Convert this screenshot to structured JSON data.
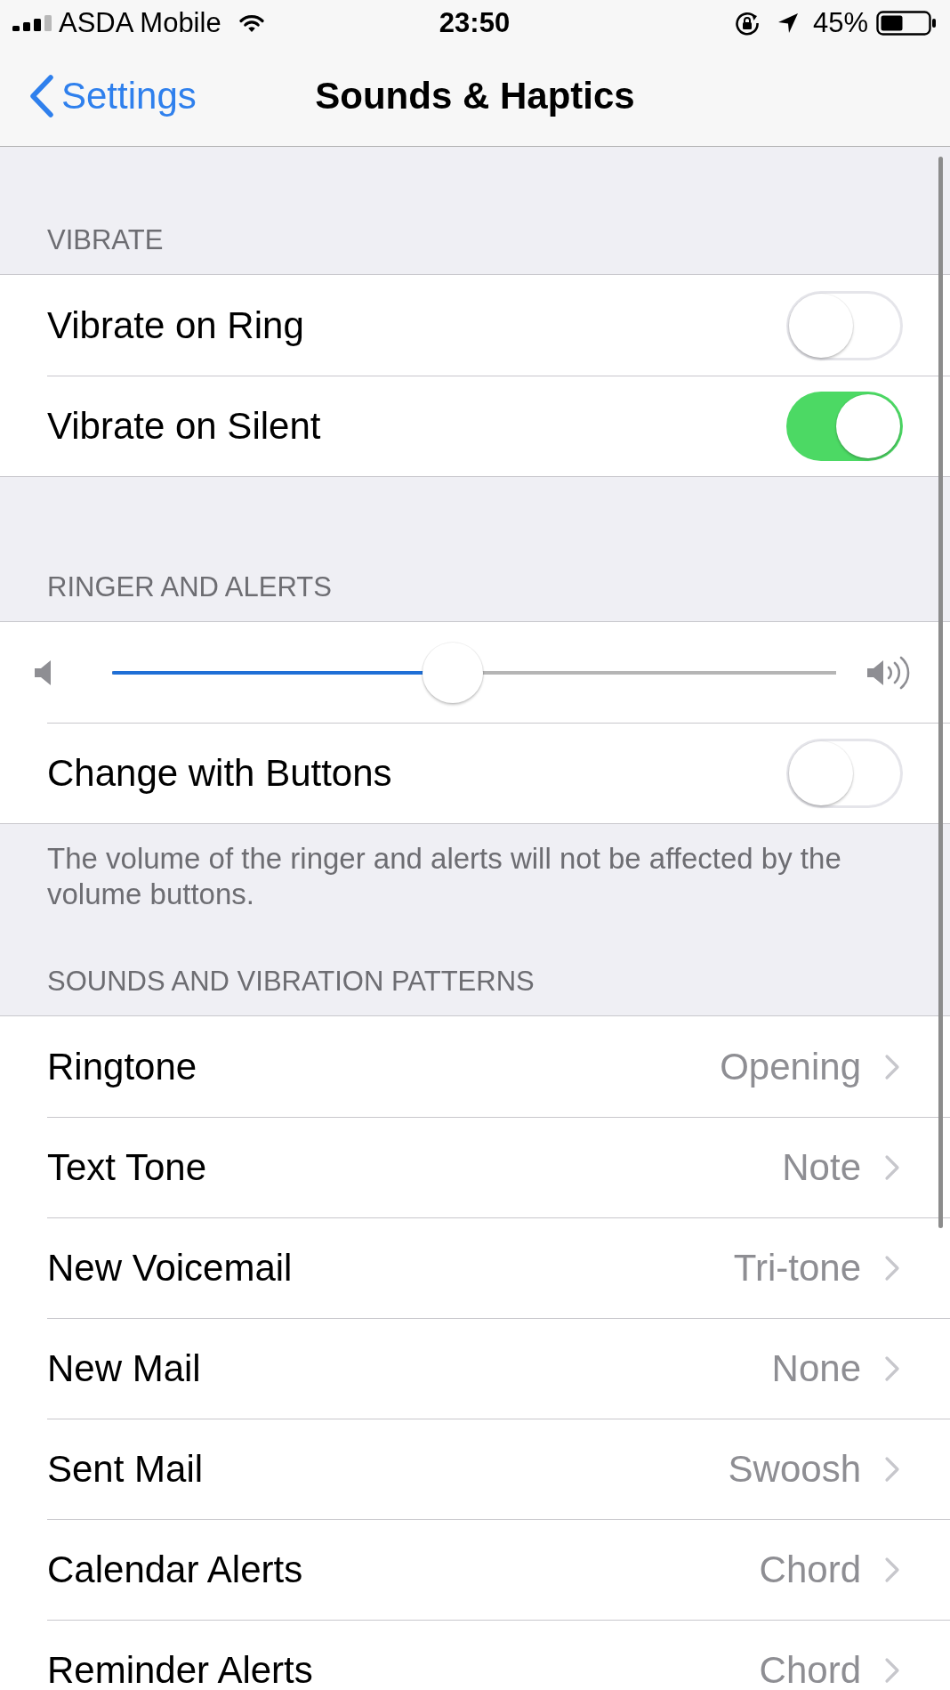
{
  "status_bar": {
    "carrier": "ASDA Mobile",
    "time": "23:50",
    "battery": "45%"
  },
  "nav_bar": {
    "back": "Settings",
    "title": "Sounds & Haptics"
  },
  "sections": [
    {
      "header": "VIBRATE",
      "rows": [
        {
          "kind": "toggle",
          "label": "Vibrate on Ring",
          "on": false
        },
        {
          "kind": "toggle",
          "label": "Vibrate on Silent",
          "on": true
        }
      ]
    },
    {
      "header": "RINGER AND ALERTS",
      "rows": [
        {
          "kind": "slider",
          "level": 0.47
        },
        {
          "kind": "toggle",
          "label": "Change with Buttons",
          "on": false
        }
      ],
      "footer": "The volume of the ringer and alerts will not be affected by the volume buttons."
    },
    {
      "header": "SOUNDS AND VIBRATION PATTERNS",
      "rows": [
        {
          "kind": "link",
          "label": "Ringtone",
          "value": "Opening"
        },
        {
          "kind": "link",
          "label": "Text Tone",
          "value": "Note"
        },
        {
          "kind": "link",
          "label": "New Voicemail",
          "value": "Tri-tone"
        },
        {
          "kind": "link",
          "label": "New Mail",
          "value": "None"
        },
        {
          "kind": "link",
          "label": "Sent Mail",
          "value": "Swoosh"
        },
        {
          "kind": "link",
          "label": "Calendar Alerts",
          "value": "Chord"
        },
        {
          "kind": "link",
          "label": "Reminder Alerts",
          "value": "Chord"
        }
      ]
    }
  ]
}
